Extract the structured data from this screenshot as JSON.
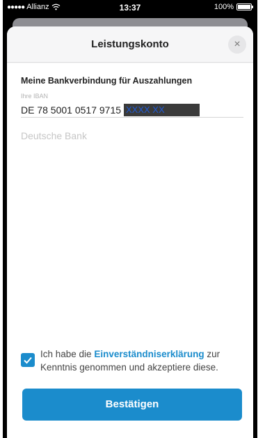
{
  "status_bar": {
    "carrier": "Allianz",
    "signal": "●●●●●",
    "wifi": "wifi-icon",
    "time": "13:37",
    "battery": "100%"
  },
  "sheet": {
    "title": "Leistungskonto",
    "close": "×"
  },
  "form": {
    "section_title": "Meine Bankverbindung für Auszahlungen",
    "iban_label": "Ihre IBAN",
    "iban_visible": "DE 78 5001 0517 9715",
    "iban_masked": "XXXX XX",
    "bank_name": "Deutsche Bank"
  },
  "consent": {
    "checked": true,
    "text_before": "Ich habe die ",
    "link_text": "Einverständniserklärung",
    "text_after": " zur Kenntnis genommen und akzeptiere diese."
  },
  "actions": {
    "confirm_label": "Bestätigen"
  },
  "colors": {
    "accent": "#1b8ccc"
  }
}
